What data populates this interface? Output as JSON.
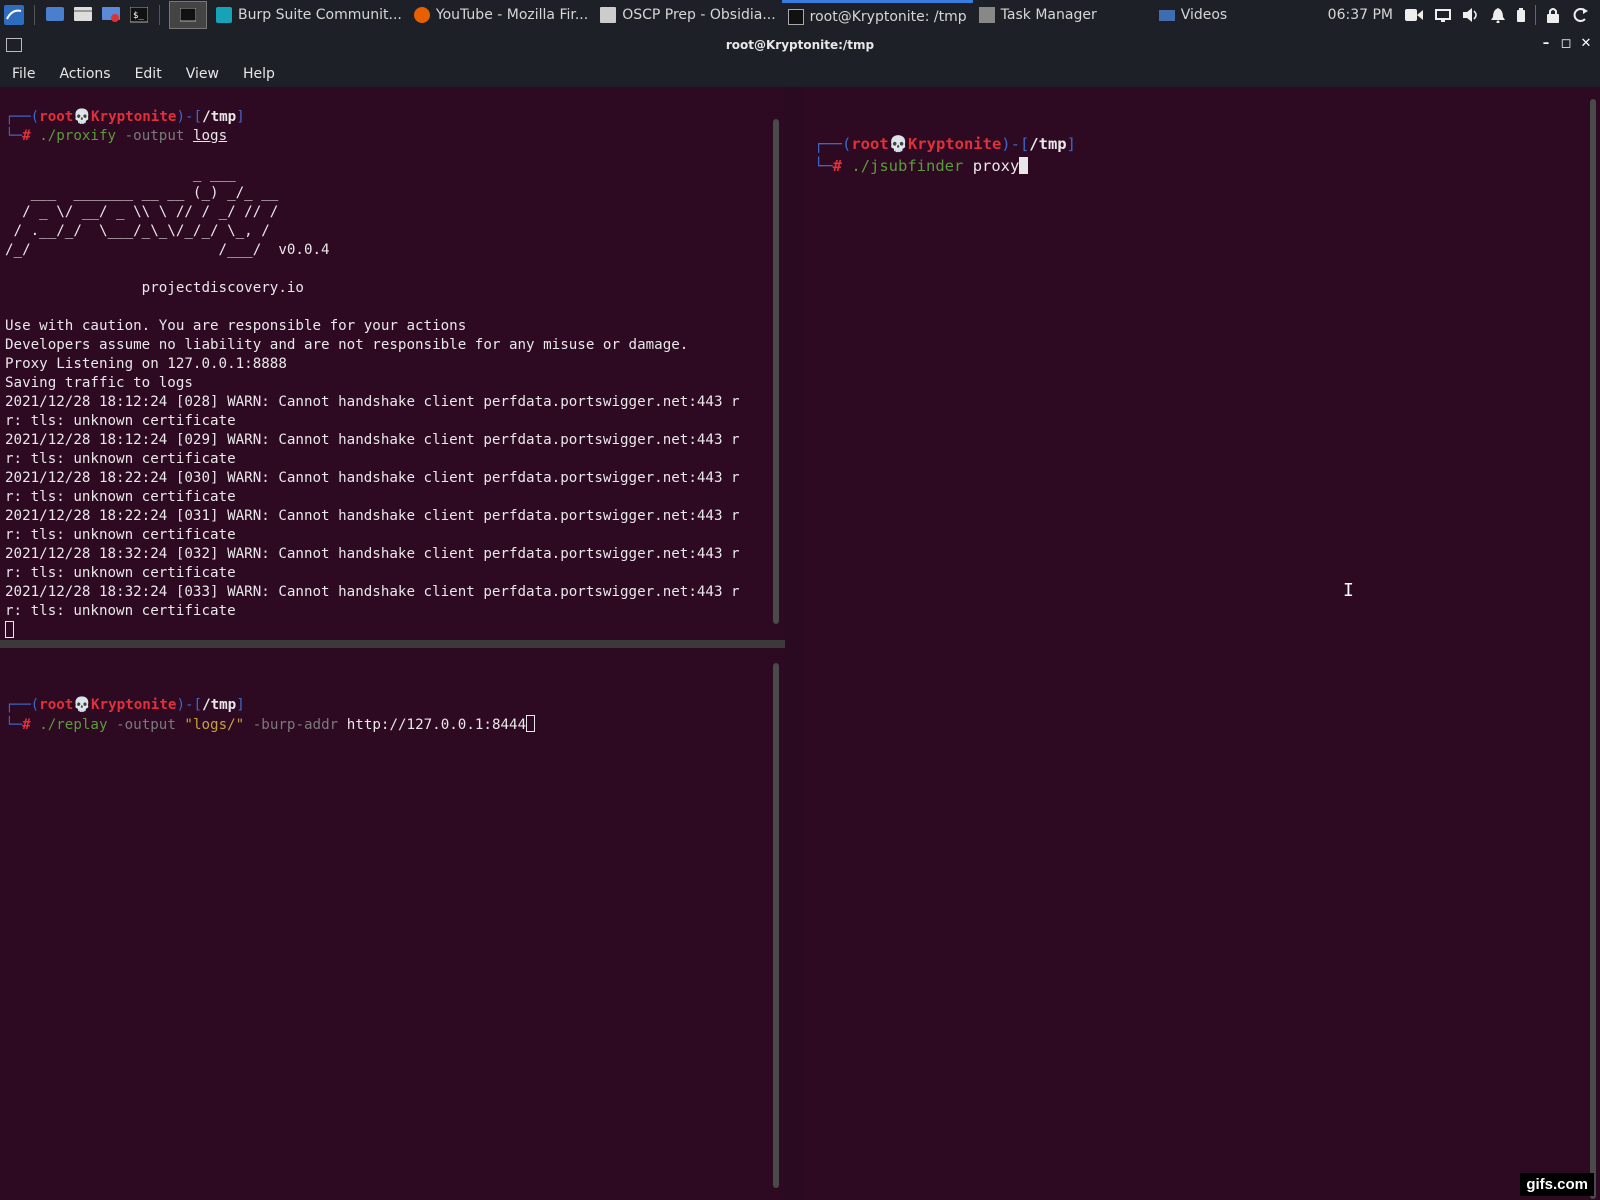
{
  "taskbar": {
    "tasks": [
      {
        "label": "Burp Suite Communit...",
        "icon": "burp-icon"
      },
      {
        "label": "YouTube - Mozilla Fir...",
        "icon": "firefox-icon"
      },
      {
        "label": "OSCP Prep - Obsidia...",
        "icon": "obsidian-icon"
      },
      {
        "label": "root@Kryptonite: /tmp",
        "icon": "terminal-icon",
        "active": true
      },
      {
        "label": "Task Manager",
        "icon": "task-manager-icon"
      },
      {
        "label": "Videos",
        "icon": "folder-icon"
      }
    ],
    "clock": "06:37 PM"
  },
  "window": {
    "title": "root@Kryptonite:/tmp",
    "menu": [
      "File",
      "Actions",
      "Edit",
      "View",
      "Help"
    ]
  },
  "prompt": {
    "user": "root",
    "skull": "💀",
    "host": "Kryptonite",
    "path": "/tmp",
    "hash": "#"
  },
  "pane_top_left": {
    "cmd": "./proxify",
    "arg": "-output",
    "value": "logs",
    "banner": [
      "                      _ ___",
      "   ___  _______ __ __ (_) _/_ __",
      "  / _ \\/ __/ _ \\\\ \\ // / _/ // /",
      " / .__/_/  \\___/_\\_\\/_/_/ \\_, /",
      "/_/                      /___/  v0.0.4"
    ],
    "site": "                projectdiscovery.io",
    "output": [
      "Use with caution. You are responsible for your actions",
      "Developers assume no liability and are not responsible for any misuse or damage.",
      "Proxy Listening on 127.0.0.1:8888",
      "Saving traffic to logs",
      "2021/12/28 18:12:24 [028] WARN: Cannot handshake client perfdata.portswigger.net:443 r",
      "r: tls: unknown certificate",
      "2021/12/28 18:12:24 [029] WARN: Cannot handshake client perfdata.portswigger.net:443 r",
      "r: tls: unknown certificate",
      "2021/12/28 18:22:24 [030] WARN: Cannot handshake client perfdata.portswigger.net:443 r",
      "r: tls: unknown certificate",
      "2021/12/28 18:22:24 [031] WARN: Cannot handshake client perfdata.portswigger.net:443 r",
      "r: tls: unknown certificate",
      "2021/12/28 18:32:24 [032] WARN: Cannot handshake client perfdata.portswigger.net:443 r",
      "r: tls: unknown certificate",
      "2021/12/28 18:32:24 [033] WARN: Cannot handshake client perfdata.portswigger.net:443 r",
      "r: tls: unknown certificate"
    ]
  },
  "pane_bottom_left": {
    "cmd": "./replay",
    "arg1": "-output",
    "str": "\"logs/\"",
    "arg2": "-burp-addr",
    "value": "http://127.0.0.1:8444"
  },
  "pane_right": {
    "cmd": "./jsubfinder",
    "value": "proxy"
  },
  "watermark": "gifs.com"
}
